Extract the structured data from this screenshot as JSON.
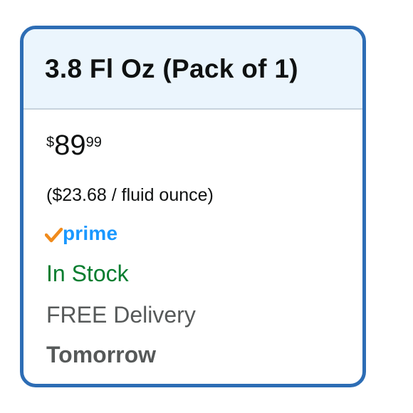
{
  "option": {
    "title": "3.8 Fl Oz (Pack of 1)"
  },
  "price": {
    "symbol": "$",
    "whole": "89",
    "fraction": "99",
    "unit_price": "($23.68 / fluid ounce)"
  },
  "badges": {
    "prime_label": "prime",
    "prime_check_icon": "prime-check-icon"
  },
  "availability": {
    "stock": "In Stock",
    "delivery": "FREE Delivery",
    "delivery_date": "Tomorrow"
  },
  "colors": {
    "border": "#2d6db5",
    "header_bg": "#ebf5fd",
    "prime_blue": "#1a98ff",
    "prime_check": "#f08b1d",
    "in_stock_green": "#067d2f",
    "secondary_text": "#565959"
  }
}
